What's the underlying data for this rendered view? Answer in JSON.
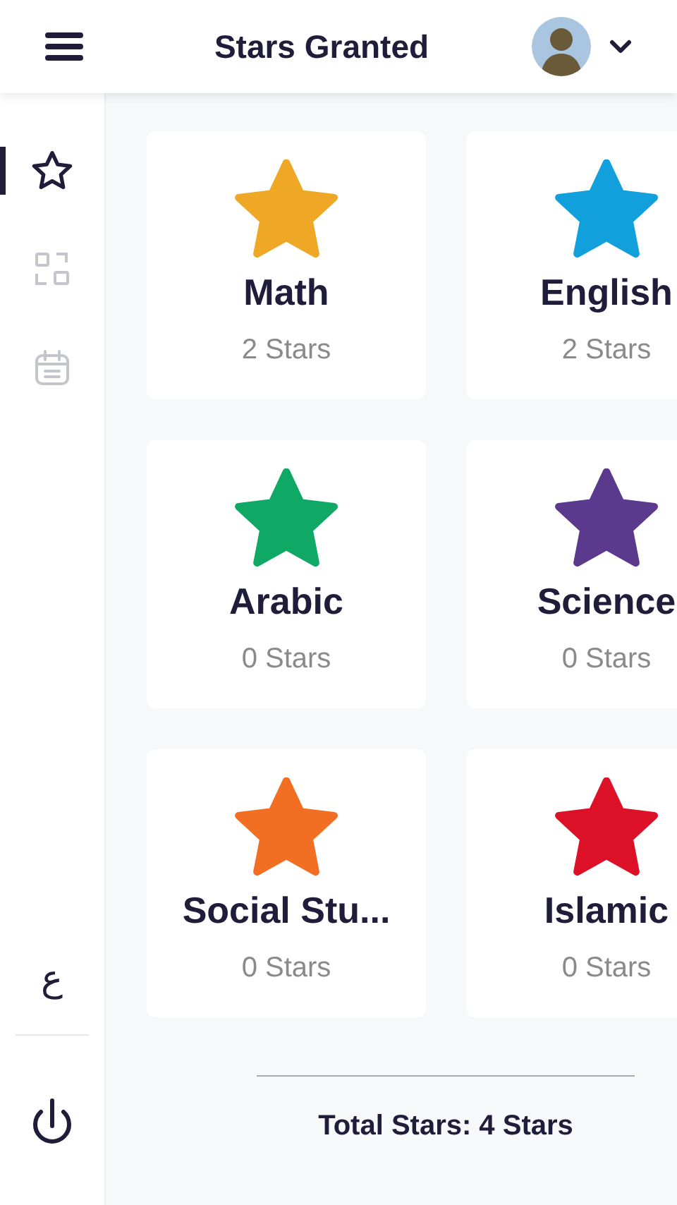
{
  "header": {
    "title": "Stars Granted"
  },
  "sidebar": {
    "items": [
      {
        "kind": "star",
        "selected": true
      },
      {
        "kind": "grid",
        "selected": false
      },
      {
        "kind": "calendar",
        "selected": false
      }
    ],
    "language": "ع"
  },
  "subjects": [
    {
      "name": "Math",
      "stars": "2 Stars",
      "color": "#eea825"
    },
    {
      "name": "English",
      "stars": "2 Stars",
      "color": "#11a0db"
    },
    {
      "name": "Arabic",
      "stars": "0 Stars",
      "color": "#10a865"
    },
    {
      "name": "Science",
      "stars": "0 Stars",
      "color": "#5b3a8e"
    },
    {
      "name": "Social Stu...",
      "stars": "0 Stars",
      "color": "#f26e22"
    },
    {
      "name": "Islamic",
      "stars": "0 Stars",
      "color": "#dc1128"
    }
  ],
  "total": "Total Stars: 4 Stars"
}
